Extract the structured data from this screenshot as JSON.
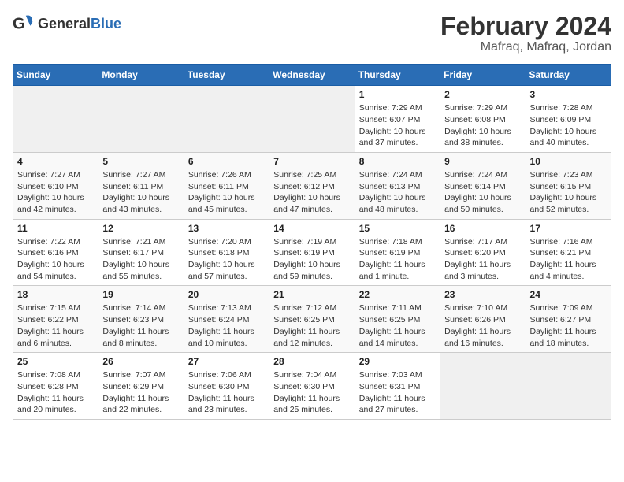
{
  "logo": {
    "text_general": "General",
    "text_blue": "Blue"
  },
  "title": "February 2024",
  "subtitle": "Mafraq, Mafraq, Jordan",
  "weekdays": [
    "Sunday",
    "Monday",
    "Tuesday",
    "Wednesday",
    "Thursday",
    "Friday",
    "Saturday"
  ],
  "weeks": [
    [
      {
        "day": "",
        "sunrise": "",
        "sunset": "",
        "daylight": "",
        "empty": true
      },
      {
        "day": "",
        "sunrise": "",
        "sunset": "",
        "daylight": "",
        "empty": true
      },
      {
        "day": "",
        "sunrise": "",
        "sunset": "",
        "daylight": "",
        "empty": true
      },
      {
        "day": "",
        "sunrise": "",
        "sunset": "",
        "daylight": "",
        "empty": true
      },
      {
        "day": "1",
        "sunrise": "Sunrise: 7:29 AM",
        "sunset": "Sunset: 6:07 PM",
        "daylight": "Daylight: 10 hours and 37 minutes.",
        "empty": false
      },
      {
        "day": "2",
        "sunrise": "Sunrise: 7:29 AM",
        "sunset": "Sunset: 6:08 PM",
        "daylight": "Daylight: 10 hours and 38 minutes.",
        "empty": false
      },
      {
        "day": "3",
        "sunrise": "Sunrise: 7:28 AM",
        "sunset": "Sunset: 6:09 PM",
        "daylight": "Daylight: 10 hours and 40 minutes.",
        "empty": false
      }
    ],
    [
      {
        "day": "4",
        "sunrise": "Sunrise: 7:27 AM",
        "sunset": "Sunset: 6:10 PM",
        "daylight": "Daylight: 10 hours and 42 minutes.",
        "empty": false
      },
      {
        "day": "5",
        "sunrise": "Sunrise: 7:27 AM",
        "sunset": "Sunset: 6:11 PM",
        "daylight": "Daylight: 10 hours and 43 minutes.",
        "empty": false
      },
      {
        "day": "6",
        "sunrise": "Sunrise: 7:26 AM",
        "sunset": "Sunset: 6:11 PM",
        "daylight": "Daylight: 10 hours and 45 minutes.",
        "empty": false
      },
      {
        "day": "7",
        "sunrise": "Sunrise: 7:25 AM",
        "sunset": "Sunset: 6:12 PM",
        "daylight": "Daylight: 10 hours and 47 minutes.",
        "empty": false
      },
      {
        "day": "8",
        "sunrise": "Sunrise: 7:24 AM",
        "sunset": "Sunset: 6:13 PM",
        "daylight": "Daylight: 10 hours and 48 minutes.",
        "empty": false
      },
      {
        "day": "9",
        "sunrise": "Sunrise: 7:24 AM",
        "sunset": "Sunset: 6:14 PM",
        "daylight": "Daylight: 10 hours and 50 minutes.",
        "empty": false
      },
      {
        "day": "10",
        "sunrise": "Sunrise: 7:23 AM",
        "sunset": "Sunset: 6:15 PM",
        "daylight": "Daylight: 10 hours and 52 minutes.",
        "empty": false
      }
    ],
    [
      {
        "day": "11",
        "sunrise": "Sunrise: 7:22 AM",
        "sunset": "Sunset: 6:16 PM",
        "daylight": "Daylight: 10 hours and 54 minutes.",
        "empty": false
      },
      {
        "day": "12",
        "sunrise": "Sunrise: 7:21 AM",
        "sunset": "Sunset: 6:17 PM",
        "daylight": "Daylight: 10 hours and 55 minutes.",
        "empty": false
      },
      {
        "day": "13",
        "sunrise": "Sunrise: 7:20 AM",
        "sunset": "Sunset: 6:18 PM",
        "daylight": "Daylight: 10 hours and 57 minutes.",
        "empty": false
      },
      {
        "day": "14",
        "sunrise": "Sunrise: 7:19 AM",
        "sunset": "Sunset: 6:19 PM",
        "daylight": "Daylight: 10 hours and 59 minutes.",
        "empty": false
      },
      {
        "day": "15",
        "sunrise": "Sunrise: 7:18 AM",
        "sunset": "Sunset: 6:19 PM",
        "daylight": "Daylight: 11 hours and 1 minute.",
        "empty": false
      },
      {
        "day": "16",
        "sunrise": "Sunrise: 7:17 AM",
        "sunset": "Sunset: 6:20 PM",
        "daylight": "Daylight: 11 hours and 3 minutes.",
        "empty": false
      },
      {
        "day": "17",
        "sunrise": "Sunrise: 7:16 AM",
        "sunset": "Sunset: 6:21 PM",
        "daylight": "Daylight: 11 hours and 4 minutes.",
        "empty": false
      }
    ],
    [
      {
        "day": "18",
        "sunrise": "Sunrise: 7:15 AM",
        "sunset": "Sunset: 6:22 PM",
        "daylight": "Daylight: 11 hours and 6 minutes.",
        "empty": false
      },
      {
        "day": "19",
        "sunrise": "Sunrise: 7:14 AM",
        "sunset": "Sunset: 6:23 PM",
        "daylight": "Daylight: 11 hours and 8 minutes.",
        "empty": false
      },
      {
        "day": "20",
        "sunrise": "Sunrise: 7:13 AM",
        "sunset": "Sunset: 6:24 PM",
        "daylight": "Daylight: 11 hours and 10 minutes.",
        "empty": false
      },
      {
        "day": "21",
        "sunrise": "Sunrise: 7:12 AM",
        "sunset": "Sunset: 6:25 PM",
        "daylight": "Daylight: 11 hours and 12 minutes.",
        "empty": false
      },
      {
        "day": "22",
        "sunrise": "Sunrise: 7:11 AM",
        "sunset": "Sunset: 6:25 PM",
        "daylight": "Daylight: 11 hours and 14 minutes.",
        "empty": false
      },
      {
        "day": "23",
        "sunrise": "Sunrise: 7:10 AM",
        "sunset": "Sunset: 6:26 PM",
        "daylight": "Daylight: 11 hours and 16 minutes.",
        "empty": false
      },
      {
        "day": "24",
        "sunrise": "Sunrise: 7:09 AM",
        "sunset": "Sunset: 6:27 PM",
        "daylight": "Daylight: 11 hours and 18 minutes.",
        "empty": false
      }
    ],
    [
      {
        "day": "25",
        "sunrise": "Sunrise: 7:08 AM",
        "sunset": "Sunset: 6:28 PM",
        "daylight": "Daylight: 11 hours and 20 minutes.",
        "empty": false
      },
      {
        "day": "26",
        "sunrise": "Sunrise: 7:07 AM",
        "sunset": "Sunset: 6:29 PM",
        "daylight": "Daylight: 11 hours and 22 minutes.",
        "empty": false
      },
      {
        "day": "27",
        "sunrise": "Sunrise: 7:06 AM",
        "sunset": "Sunset: 6:30 PM",
        "daylight": "Daylight: 11 hours and 23 minutes.",
        "empty": false
      },
      {
        "day": "28",
        "sunrise": "Sunrise: 7:04 AM",
        "sunset": "Sunset: 6:30 PM",
        "daylight": "Daylight: 11 hours and 25 minutes.",
        "empty": false
      },
      {
        "day": "29",
        "sunrise": "Sunrise: 7:03 AM",
        "sunset": "Sunset: 6:31 PM",
        "daylight": "Daylight: 11 hours and 27 minutes.",
        "empty": false
      },
      {
        "day": "",
        "sunrise": "",
        "sunset": "",
        "daylight": "",
        "empty": true
      },
      {
        "day": "",
        "sunrise": "",
        "sunset": "",
        "daylight": "",
        "empty": true
      }
    ]
  ]
}
